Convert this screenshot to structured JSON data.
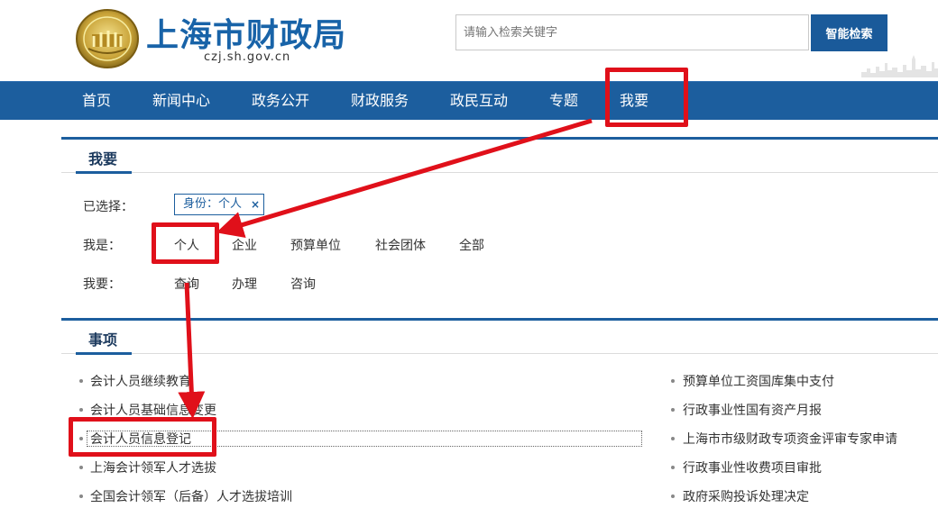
{
  "header": {
    "title": "上海市财政局",
    "domain": "czj.sh.gov.cn",
    "search_placeholder": "请输入检索关键字",
    "search_button": "智能检索"
  },
  "nav": [
    "首页",
    "新闻中心",
    "政务公开",
    "财政服务",
    "政民互动",
    "专题",
    "我要"
  ],
  "woyao": {
    "title": "我要",
    "selected_label": "已选择：",
    "chip": "身份：个人",
    "identity_label": "我是：",
    "identity_options": [
      "个人",
      "企业",
      "预算单位",
      "社会团体",
      "全部"
    ],
    "want_label": "我要：",
    "want_options": [
      "查询",
      "办理",
      "咨询"
    ]
  },
  "items": {
    "title": "事项",
    "left": [
      "会计人员继续教育",
      "会计人员基础信息变更",
      "会计人员信息登记",
      "上海会计领军人才选拔",
      "全国会计领军（后备）人才选拔培训"
    ],
    "right": [
      "预算单位工资国库集中支付",
      "行政事业性国有资产月报",
      "上海市市级财政专项资金评审专家申请",
      "行政事业性收费项目审批",
      "政府采购投诉处理决定"
    ]
  },
  "colors": {
    "primary": "#1c5e9e",
    "annotation": "#e0101a"
  }
}
